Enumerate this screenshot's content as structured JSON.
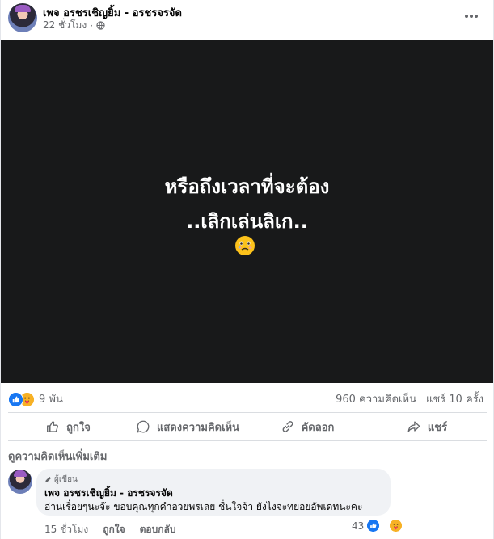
{
  "post": {
    "page_name": "เพจ อรชรเชิญยิ้ม - อรชรจรจัด",
    "time": "22 ชั่วโมง",
    "privacy_icon": "globe-icon",
    "more_icon": "more-horizontal-icon"
  },
  "media": {
    "line1": "หรือถึงเวลาที่จะต้อง",
    "line2": "..เลิกเล่นลิเก..",
    "emoji": "face-holding-back-tears-emoji"
  },
  "stats": {
    "reaction_count": "9 พัน",
    "comments": "960 ความคิดเห็น",
    "shares": "แชร์ 10 ครั้ง"
  },
  "actions": [
    {
      "label": "ถูกใจ",
      "icon": "like-icon"
    },
    {
      "label": "แสดงความคิดเห็น",
      "icon": "comment-icon"
    },
    {
      "label": "คัดลอก",
      "icon": "link-icon"
    },
    {
      "label": "แชร์",
      "icon": "share-icon"
    }
  ],
  "comments_section": {
    "more_label": "ดูความคิดเห็นเพิ่มเติม",
    "comment": {
      "badge": "ผู้เขียน",
      "author": "เพจ อรชรเชิญยิ้ม - อรชรจรจัด",
      "text": "อ่านเรื่อยๆนะจ๊ะ ขอบคุณทุกคำอวยพรเลย ชื่นใจจ้า ยังไงจะทยอยอัพเดทนะคะ",
      "time": "15 ชั่วโมง",
      "like_label": "ถูกใจ",
      "reply_label": "ตอบกลับ",
      "reaction_count": "43"
    }
  },
  "colors": {
    "like_blue": "#1877f2",
    "care_yellow": "#f7b125",
    "media_bg": "#18191a",
    "secondary_text": "#65676b"
  }
}
